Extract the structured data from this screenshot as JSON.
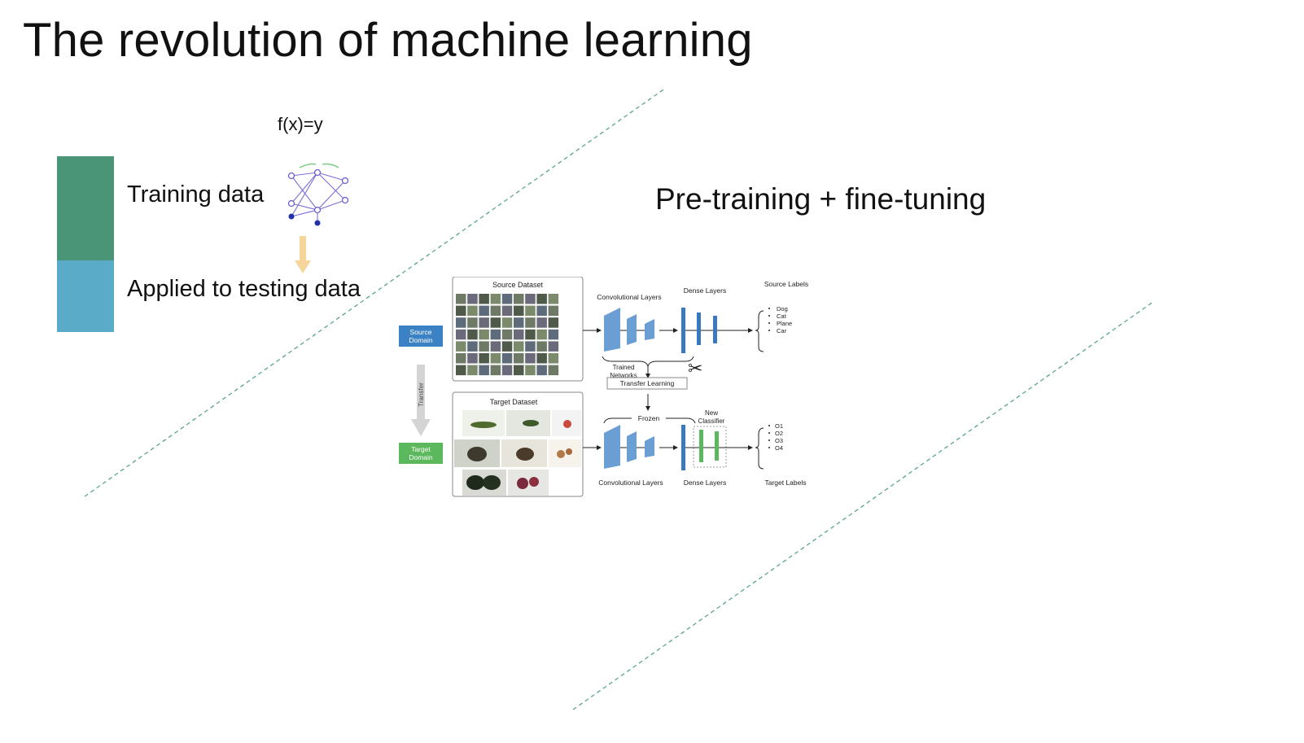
{
  "slide": {
    "title": "The revolution of machine learning",
    "formula": "f(x)=y",
    "training_label": "Training data",
    "testing_label": "Applied to testing data",
    "right_title": "Pre-training + fine-tuning",
    "colors": {
      "training": "#4a9577",
      "testing": "#5aabc8",
      "arrow": "#f5d59a",
      "divider": "#5aa58a"
    }
  },
  "diagram": {
    "source_dataset": "Source Dataset",
    "target_dataset": "Target Dataset",
    "source_domain": [
      "Source",
      "Domain"
    ],
    "target_domain": [
      "Target",
      "Domain"
    ],
    "transfer": "Transfer",
    "conv_top": "Convolutional Layers",
    "dense_top": "Dense Layers",
    "source_labels": "Source Labels",
    "source_label_items": [
      "Dog",
      "Cat",
      "Plane",
      "Car"
    ],
    "trained_networks": [
      "Trained",
      "Networks"
    ],
    "transfer_learning": "Transfer Learning",
    "frozen": "Frozen",
    "new_classifier": [
      "New",
      "Classifier"
    ],
    "conv_bottom": "Convolutional Layers",
    "dense_bottom": "Dense Layers",
    "target_labels": "Target Labels",
    "target_label_items": [
      "O1",
      "O2",
      "O3",
      "O4"
    ],
    "colors": {
      "domain_source": "#3b82c4",
      "domain_target": "#5cb85c",
      "layer": "#6b9fd4",
      "dense": "#3a78c0",
      "classifier": "#5cb85c"
    }
  }
}
